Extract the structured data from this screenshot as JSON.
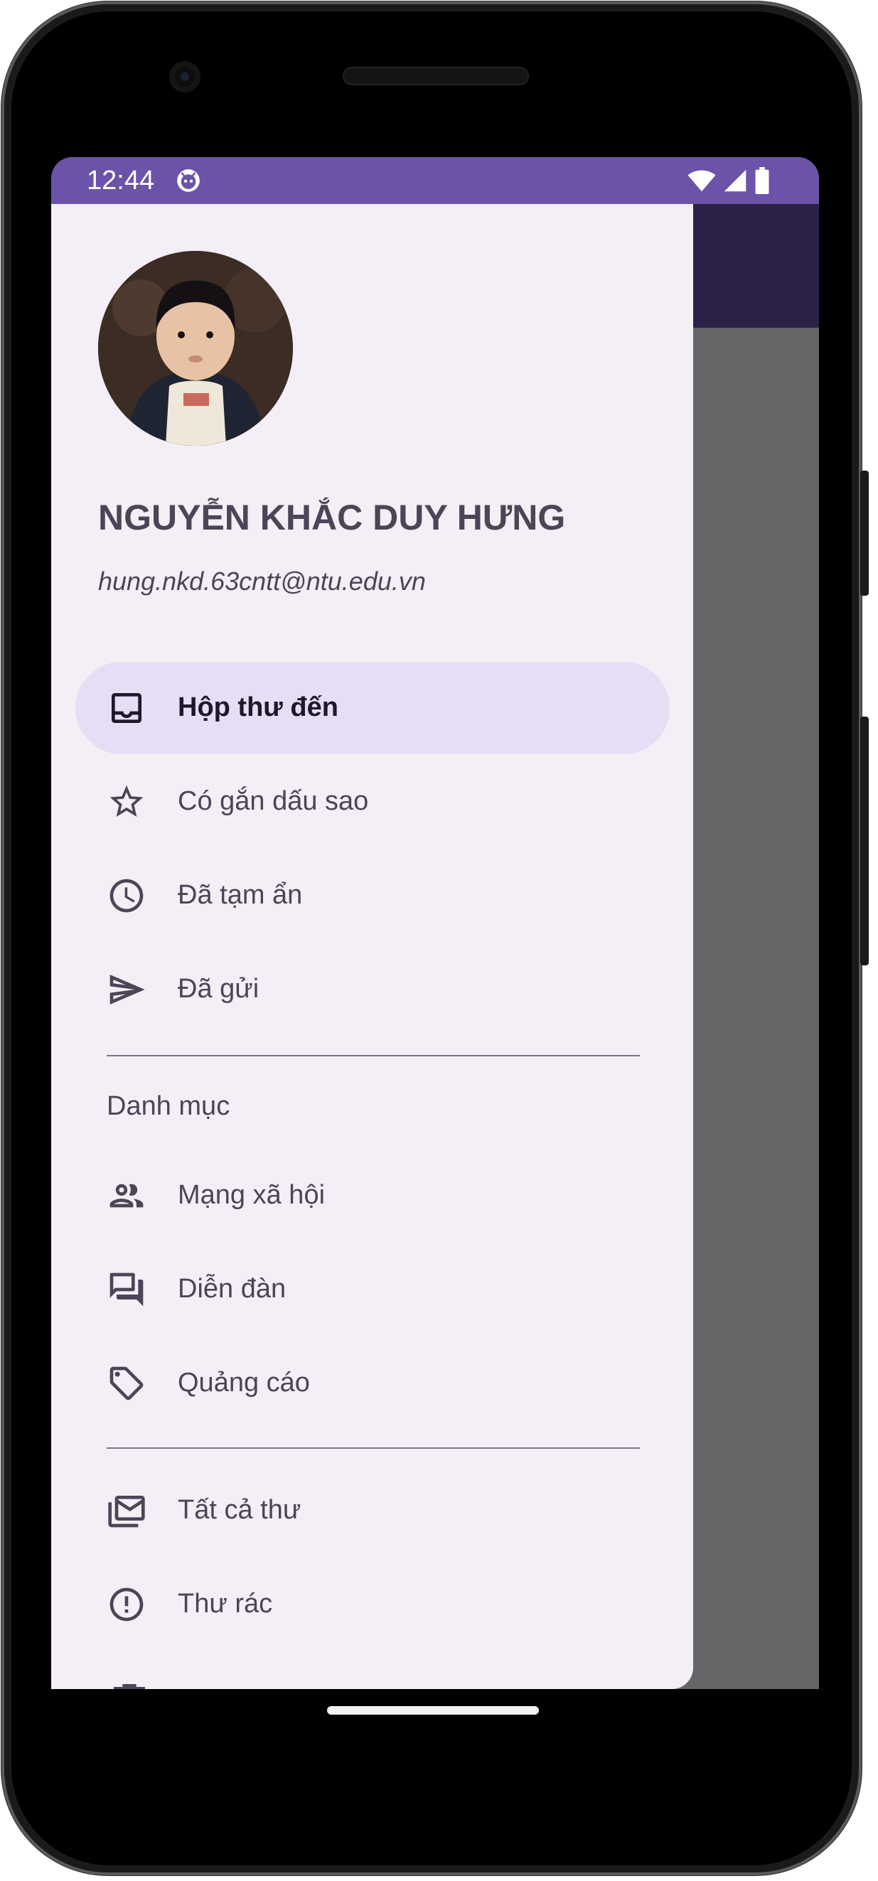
{
  "status_bar": {
    "time": "12:44",
    "icons": [
      "debug-app-icon",
      "wifi-icon",
      "cell-signal-icon",
      "battery-icon"
    ]
  },
  "drawer": {
    "user": {
      "name": "NGUYỄN KHẮC DUY HƯNG",
      "email": "hung.nkd.63cntt@ntu.edu.vn"
    },
    "items": [
      {
        "label": "Hộp thư đến",
        "icon": "inbox-icon",
        "active": true
      },
      {
        "label": "Có gắn dấu sao",
        "icon": "star-icon",
        "active": false
      },
      {
        "label": "Đã tạm ẩn",
        "icon": "clock-icon",
        "active": false
      },
      {
        "label": "Đã gửi",
        "icon": "send-icon",
        "active": false
      }
    ],
    "section_title": "Danh mục",
    "category_items": [
      {
        "label": "Mạng xã hội",
        "icon": "people-icon"
      },
      {
        "label": "Diễn đàn",
        "icon": "forum-icon"
      },
      {
        "label": "Quảng cáo",
        "icon": "tag-icon"
      }
    ],
    "more_items": [
      {
        "label": "Tất cả thư",
        "icon": "all-mail-icon"
      },
      {
        "label": "Thư rác",
        "icon": "spam-icon"
      }
    ]
  },
  "colors": {
    "status_bar": "#6c52a8",
    "app_bar": "#2b2149",
    "drawer_bg": "#f4eff6",
    "active_item_bg": "#e7ddf5",
    "scrim": "#666568"
  }
}
